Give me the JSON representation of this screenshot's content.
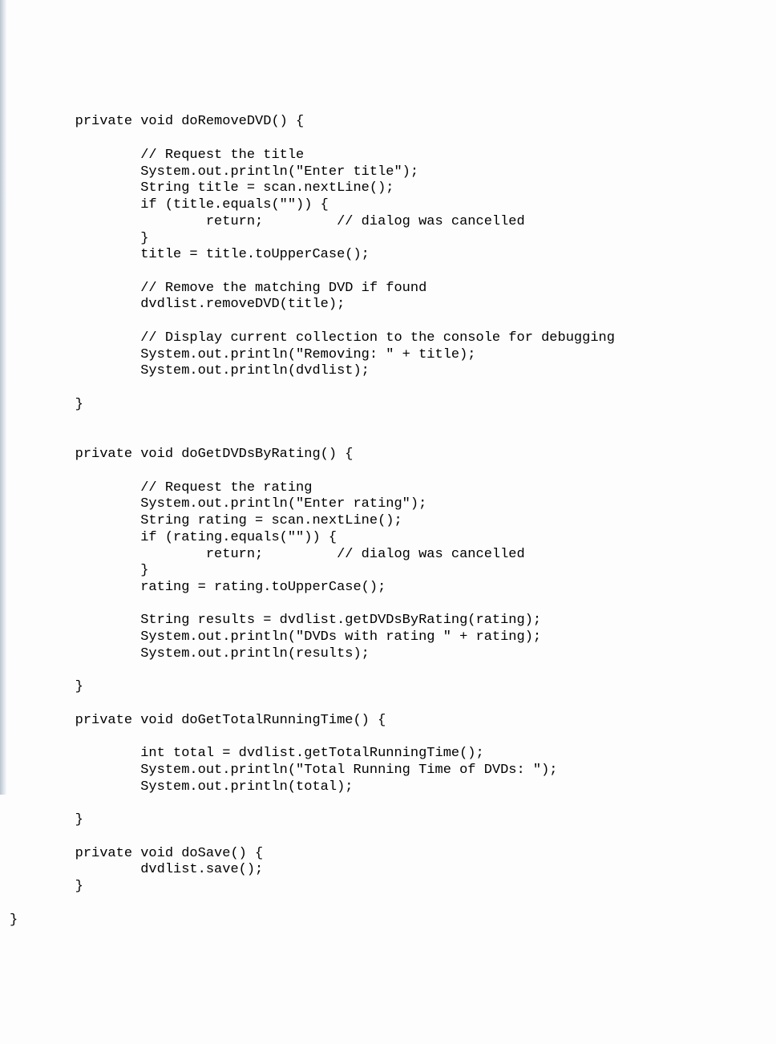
{
  "code_lines": [
    "        private void doRemoveDVD() {",
    "",
    "                // Request the title",
    "                System.out.println(\"Enter title\");",
    "                String title = scan.nextLine();",
    "                if (title.equals(\"\")) {",
    "                        return;         // dialog was cancelled",
    "                }",
    "                title = title.toUpperCase();",
    "",
    "                // Remove the matching DVD if found",
    "                dvdlist.removeDVD(title);",
    "",
    "                // Display current collection to the console for debugging",
    "                System.out.println(\"Removing: \" + title);",
    "                System.out.println(dvdlist);",
    "",
    "        }",
    "",
    "",
    "        private void doGetDVDsByRating() {",
    "",
    "                // Request the rating",
    "                System.out.println(\"Enter rating\");",
    "                String rating = scan.nextLine();",
    "                if (rating.equals(\"\")) {",
    "                        return;         // dialog was cancelled",
    "                }",
    "                rating = rating.toUpperCase();",
    "",
    "                String results = dvdlist.getDVDsByRating(rating);",
    "                System.out.println(\"DVDs with rating \" + rating);",
    "                System.out.println(results);",
    "",
    "        }",
    "",
    "        private void doGetTotalRunningTime() {",
    "",
    "                int total = dvdlist.getTotalRunningTime();",
    "                System.out.println(\"Total Running Time of DVDs: \");",
    "                System.out.println(total);",
    "",
    "        }",
    "",
    "        private void doSave() {",
    "                dvdlist.save();",
    "        }",
    "",
    "}"
  ]
}
